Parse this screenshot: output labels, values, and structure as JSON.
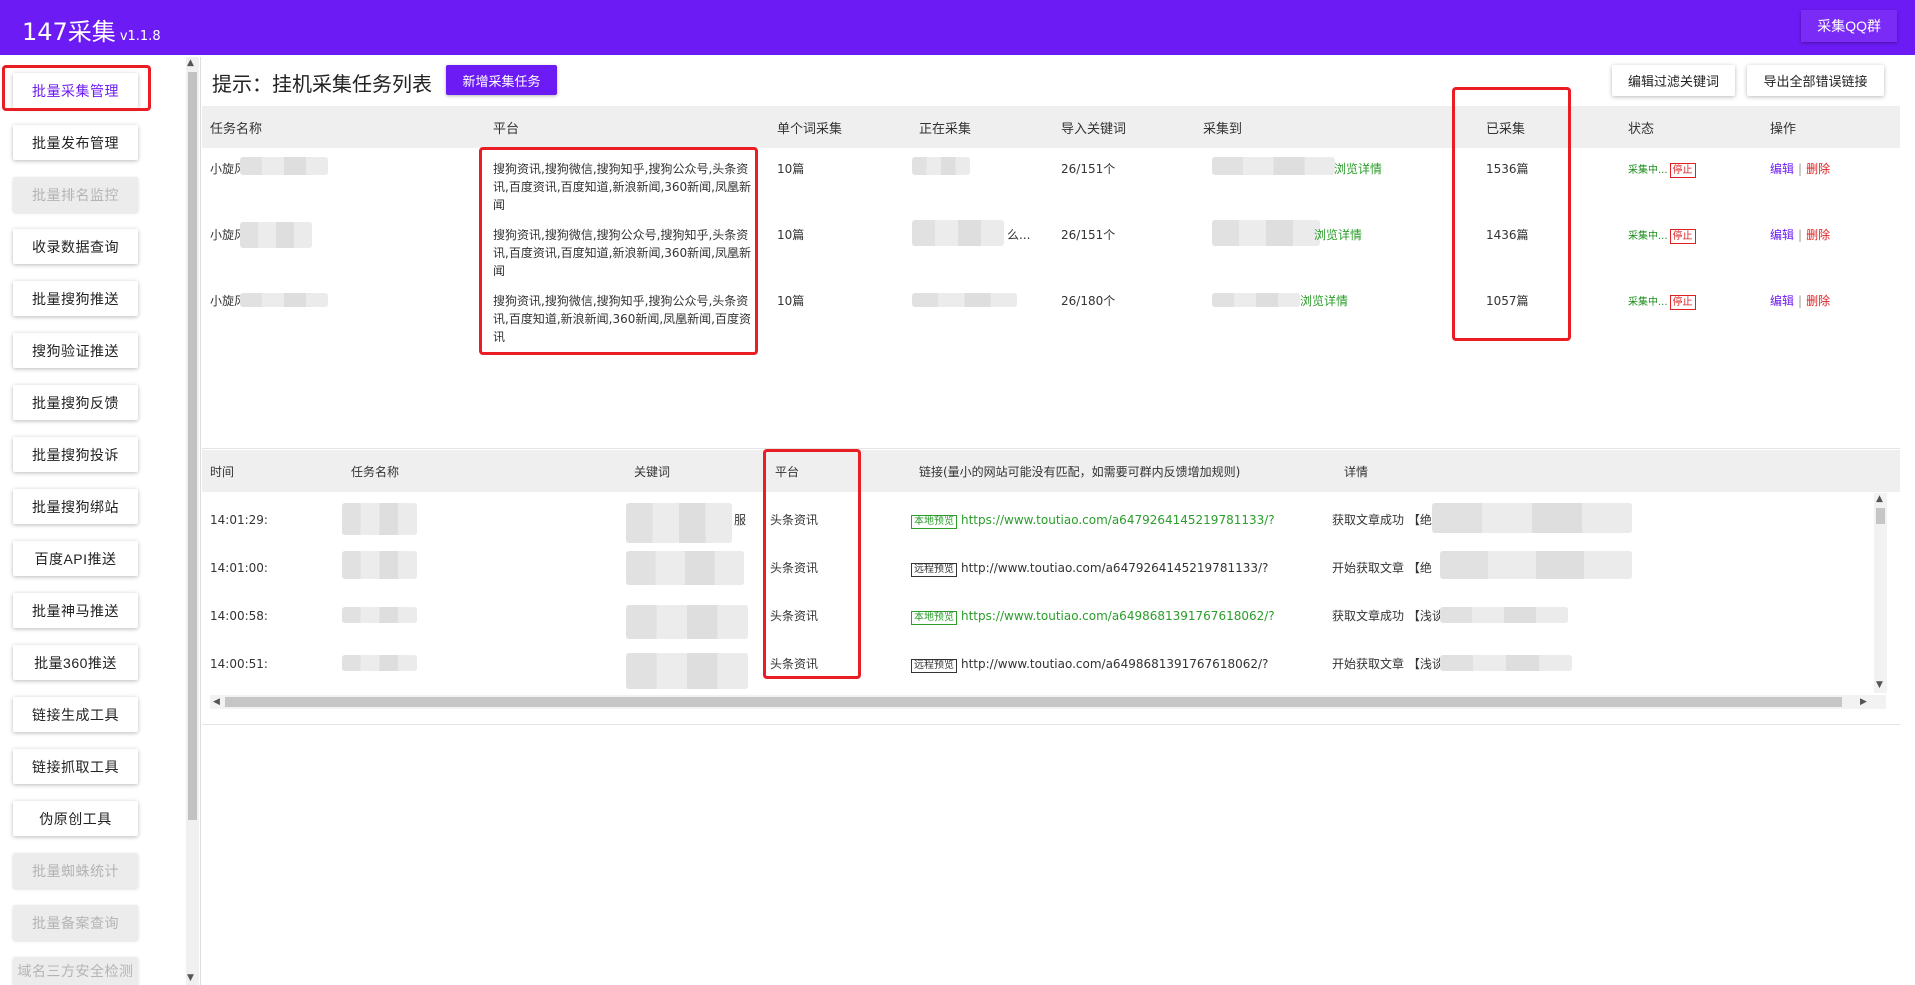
{
  "app": {
    "title": "147采集",
    "version": "v1.1.8",
    "qq_group": "采集QQ群"
  },
  "sidebar": {
    "items": [
      {
        "label": "批量采集管理",
        "state": "active"
      },
      {
        "label": "批量发布管理",
        "state": "normal"
      },
      {
        "label": "批量排名监控",
        "state": "disabled"
      },
      {
        "label": "收录数据查询",
        "state": "normal"
      },
      {
        "label": "批量搜狗推送",
        "state": "normal"
      },
      {
        "label": "搜狗验证推送",
        "state": "normal"
      },
      {
        "label": "批量搜狗反馈",
        "state": "normal"
      },
      {
        "label": "批量搜狗投诉",
        "state": "normal"
      },
      {
        "label": "批量搜狗绑站",
        "state": "normal"
      },
      {
        "label": "百度API推送",
        "state": "normal"
      },
      {
        "label": "批量神马推送",
        "state": "normal"
      },
      {
        "label": "批量360推送",
        "state": "normal"
      },
      {
        "label": "链接生成工具",
        "state": "normal"
      },
      {
        "label": "链接抓取工具",
        "state": "normal"
      },
      {
        "label": "伪原创工具",
        "state": "normal"
      },
      {
        "label": "批量蜘蛛统计",
        "state": "disabled"
      },
      {
        "label": "批量备案查询",
        "state": "disabled"
      },
      {
        "label": "域名三方安全检测",
        "state": "disabled"
      }
    ]
  },
  "main": {
    "hint": "提示：挂机采集任务列表",
    "add_task": "新增采集任务",
    "edit_filter": "编辑过滤关键词",
    "export_errors": "导出全部错误链接"
  },
  "task_table": {
    "headers": {
      "name": "任务名称",
      "platform": "平台",
      "per_word": "单个词采集",
      "collecting": "正在采集",
      "imported": "导入关键词",
      "collect_to": "采集到",
      "collected": "已采集",
      "status": "状态",
      "action": "操作"
    },
    "rows": [
      {
        "name": "小旋风",
        "platform": "搜狗资讯,搜狗微信,搜狗知乎,搜狗公众号,头条资讯,百度资讯,百度知道,新浪新闻,360新闻,凤凰新闻",
        "per_word": "10篇",
        "collecting_tail": "",
        "imported": "26/151个",
        "collect_to_link": "浏览详情",
        "collected": "1536篇",
        "status": "采集中...",
        "stop": "停止",
        "edit": "编辑",
        "delete": "删除"
      },
      {
        "name": "小旋风",
        "platform": "搜狗资讯,搜狗微信,搜狗公众号,搜狗知乎,头条资讯,百度资讯,百度知道,新浪新闻,360新闻,凤凰新闻",
        "per_word": "10篇",
        "collecting_tail": "么...",
        "imported": "26/151个",
        "collect_to_link": "浏览详情",
        "collected": "1436篇",
        "status": "采集中...",
        "stop": "停止",
        "edit": "编辑",
        "delete": "删除"
      },
      {
        "name": "小旋风",
        "platform": "搜狗资讯,搜狗微信,搜狗知乎,搜狗公众号,头条资讯,百度知道,新浪新闻,360新闻,凤凰新闻,百度资讯",
        "per_word": "10篇",
        "collecting_tail": "",
        "imported": "26/180个",
        "collect_to_link": "浏览详情",
        "collected": "1057篇",
        "status": "采集中...",
        "stop": "停止",
        "edit": "编辑",
        "delete": "删除"
      }
    ]
  },
  "log_table": {
    "headers": {
      "time": "时间",
      "task": "任务名称",
      "keyword": "关键词",
      "platform": "平台",
      "link": "链接(量小的网站可能没有匹配，如需要可群内反馈增加规则)",
      "detail": "详情"
    },
    "rows": [
      {
        "time": "14:01:29:",
        "keyword_tail": "服",
        "platform": "头条资讯",
        "tag": "本地预览",
        "tag_type": "local",
        "url": "https://www.toutiao.com/a6479264145219781133/?",
        "detail": "获取文章成功 【绝地"
      },
      {
        "time": "14:01:00:",
        "keyword_tail": "",
        "platform": "头条资讯",
        "tag": "远程预览",
        "tag_type": "remote",
        "url": "http://www.toutiao.com/a6479264145219781133/?",
        "detail": "开始获取文章 【绝"
      },
      {
        "time": "14:00:58:",
        "keyword_tail": "",
        "platform": "头条资讯",
        "tag": "本地预览",
        "tag_type": "local",
        "url": "https://www.toutiao.com/a6498681391767618062/?",
        "detail": "获取文章成功 【浅谈"
      },
      {
        "time": "14:00:51:",
        "keyword_tail": "",
        "platform": "头条资讯",
        "tag": "远程预览",
        "tag_type": "remote",
        "url": "http://www.toutiao.com/a6498681391767618062/?",
        "detail": "开始获取文章 【浅谈"
      }
    ]
  },
  "colors": {
    "brand": "#6d1bf4",
    "highlight": "#ea1c24",
    "success": "#2a9d2a",
    "danger": "#e02020"
  }
}
